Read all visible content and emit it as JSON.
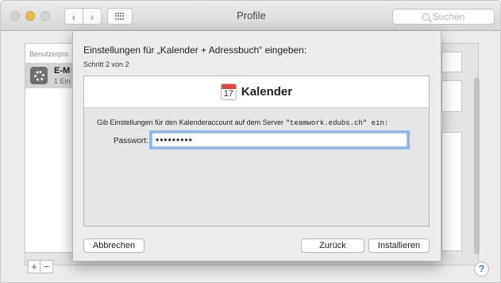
{
  "window": {
    "title": "Profile",
    "search_placeholder": "Suchen"
  },
  "sidebar": {
    "header": "Benutzerpro",
    "item_name": "E-M",
    "item_sub": "1 Ein"
  },
  "bottom": {
    "add_label": "+",
    "remove_label": "−",
    "help_label": "?"
  },
  "sheet": {
    "title": "Einstellungen für „Kalender + Adressbuch“ eingeben:",
    "step": "Schritt 2 von 2",
    "header_title": "Kalender",
    "calendar_day": "17",
    "instruction_prefix": "Gib Einstellungen für den Kalenderaccount auf dem Server ",
    "instruction_server": "\"teamwork.edubs.ch\" ein:",
    "password_label": "Passwort:",
    "password_value": "•••••••••",
    "cancel_label": "Abbrechen",
    "back_label": "Zurück",
    "install_label": "Installieren"
  },
  "colors": {
    "accent_focus": "#8cb7ef",
    "calendar_red": "#e24b3b",
    "minimize_yellow": "#e8c046",
    "help_blue": "#3478d8"
  },
  "icons": [
    "close-icon",
    "minimize-icon",
    "maximize-icon",
    "back-chevron-icon",
    "forward-chevron-icon",
    "grid-icon",
    "search-icon",
    "gear-icon",
    "calendar-icon",
    "help-icon"
  ]
}
